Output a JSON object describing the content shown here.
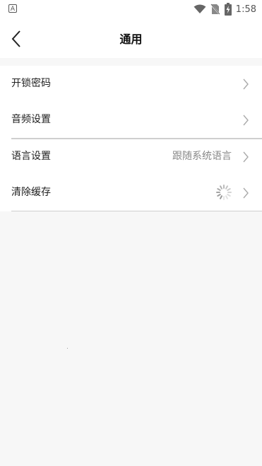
{
  "status_bar": {
    "notification_icon_letter": "A",
    "time": "1:58",
    "icons": [
      "wifi-icon",
      "no-sim-icon",
      "battery-charging-icon"
    ]
  },
  "header": {
    "title": "通用",
    "back_icon": "chevron-left-icon"
  },
  "settings": {
    "items": [
      {
        "label": "开锁密码",
        "value": ""
      },
      {
        "label": "音频设置",
        "value": ""
      },
      {
        "label": "语言设置",
        "value": "跟随系统语言"
      },
      {
        "label": "清除缓存",
        "value": ""
      }
    ]
  },
  "colors": {
    "background": "#f7f7f7",
    "surface": "#ffffff",
    "text_primary": "#222222",
    "text_secondary": "#888888",
    "divider": "#cfcfcf"
  }
}
